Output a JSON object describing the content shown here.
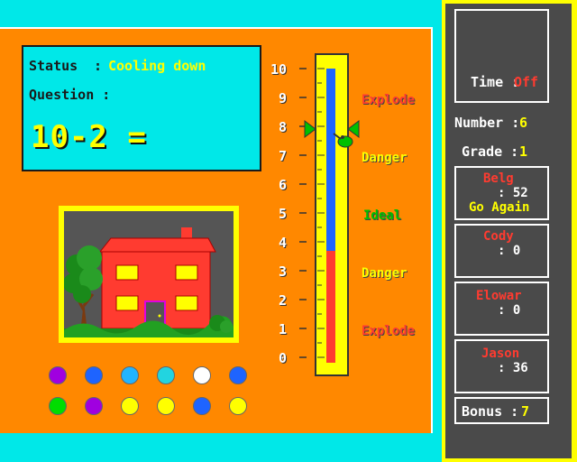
{
  "status": {
    "status_label": "Status",
    "status_sep": ":",
    "status_value": "Cooling down",
    "question_label": "Question :",
    "question_text": "10-2 ="
  },
  "scale": {
    "numbers": [
      "10",
      "9",
      "8",
      "7",
      "6",
      "5",
      "4",
      "3",
      "2",
      "1",
      "0"
    ],
    "zones": {
      "explode_top": "Explode",
      "danger_top": "Danger",
      "ideal": "Ideal",
      "danger_bottom": "Danger",
      "explode_bottom": "Explode"
    },
    "pointer_value": 8,
    "colors": {
      "explode": "#ff3b30",
      "danger": "#ffff00",
      "ideal": "#00c000",
      "blue_fill": "#1e64ff",
      "red_fill": "#ff3b30"
    }
  },
  "palette": {
    "row1": [
      "#a000e0",
      "#1e64ff",
      "#22b4ff",
      "#22d4e0",
      "#ffffff",
      "#1e64ff"
    ],
    "row2": [
      "#00dd00",
      "#a000e0",
      "#ffff00",
      "#ffff00",
      "#1e64ff",
      "#ffff00"
    ]
  },
  "sidebar": {
    "time_label": "Time :",
    "time_value": "Off",
    "number_label": "Number :",
    "number_value": "6",
    "grade_label": "Grade :",
    "grade_value": "1",
    "bonus_label": "Bonus :",
    "bonus_value": "7",
    "players": [
      {
        "name": "Belg",
        "score": ": 52",
        "note": "Go Again"
      },
      {
        "name": "Cody",
        "score": ": 0"
      },
      {
        "name": "Elowar",
        "score": ": 0"
      },
      {
        "name": "Jason",
        "score": ": 36"
      }
    ]
  }
}
